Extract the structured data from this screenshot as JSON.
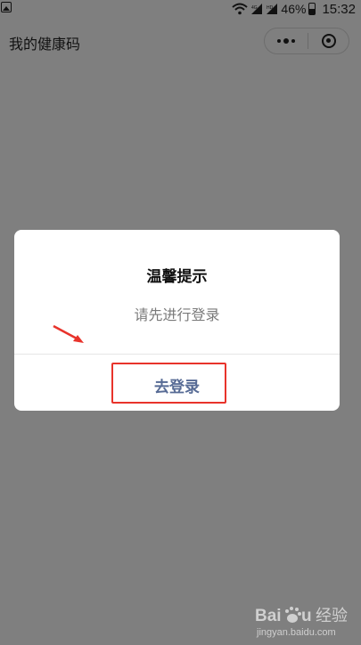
{
  "status_bar": {
    "battery_percent": "46%",
    "time": "15:32",
    "network_small_1": "4G",
    "network_small_2": "HD"
  },
  "header": {
    "title": "我的健康码"
  },
  "dialog": {
    "title": "温馨提示",
    "message": "请先进行登录",
    "button_label": "去登录"
  },
  "colors": {
    "overlay": "#7f7f7f",
    "dialog_bg": "#ffffff",
    "button_text": "#576b95",
    "message_text": "#7a7a7a",
    "annotation_red": "#e8332b"
  },
  "watermark": {
    "logo_text": "Bai du 经验",
    "url": "jingyan.baidu.com"
  }
}
